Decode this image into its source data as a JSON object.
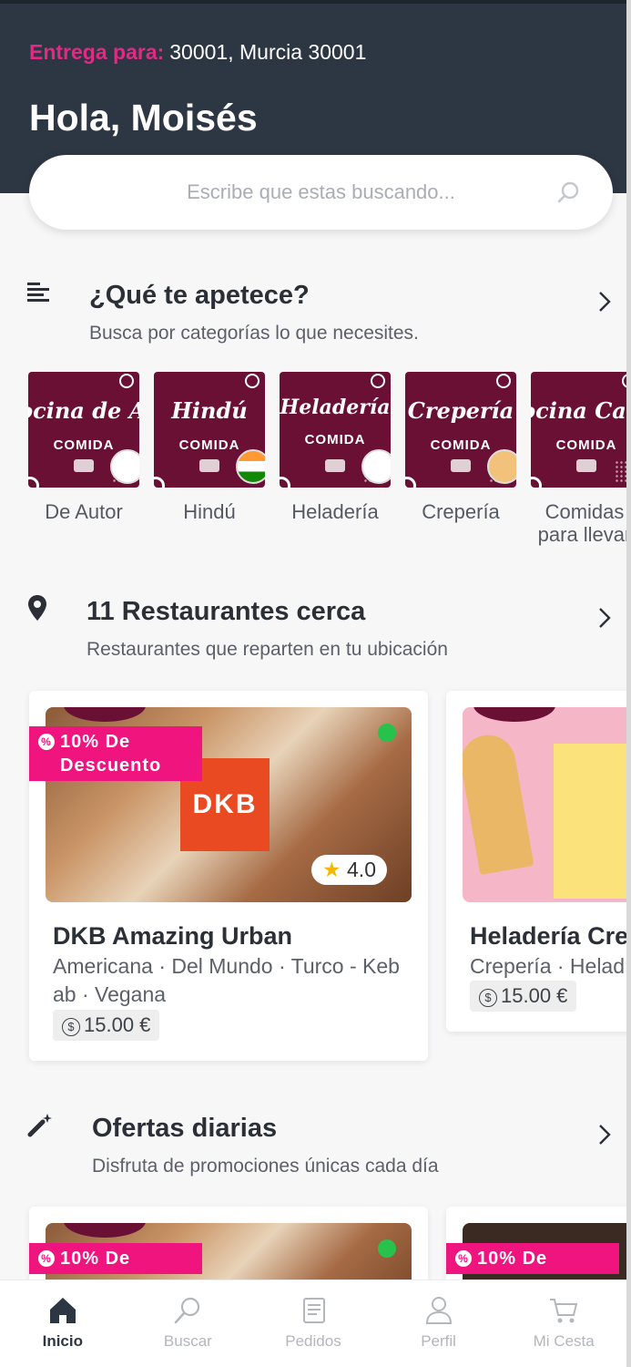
{
  "header": {
    "deliver_label": "Entrega para:",
    "address": "30001, Murcia 30001",
    "greeting": "Hola, Moisés"
  },
  "search": {
    "placeholder": "Escribe que estas buscando..."
  },
  "categories_section": {
    "title": "¿Qué te apetece?",
    "subtitle": "Busca por categorías lo que necesites.",
    "items": [
      {
        "image_title": "Cocina de Autor",
        "image_tag": "COMIDA",
        "label": "De Autor"
      },
      {
        "image_title": "Hindú",
        "image_tag": "COMIDA",
        "label": "Hindú"
      },
      {
        "image_title": "Heladería",
        "image_tag": "COMIDA",
        "label": "Heladería"
      },
      {
        "image_title": "Crepería",
        "image_tag": "COMIDA",
        "label": "Crepería"
      },
      {
        "image_title": "Cocina Casera",
        "image_tag": "COMIDA",
        "label": "Comidas para llevar"
      }
    ]
  },
  "restaurants_section": {
    "title": "11 Restaurantes cerca",
    "subtitle": "Restaurantes que reparten en tu ubicación",
    "items": [
      {
        "promo": "10% De Descuento",
        "logo_text": "DKB",
        "rating": "4.0",
        "name": "DKB Amazing Urban",
        "categories": "Americana · Del Mundo · Turco - Kebab · Vegana",
        "price": "15.00 €"
      },
      {
        "name": "Heladería Cre",
        "categories": "Crepería · Helad",
        "price": "15.00 €"
      }
    ]
  },
  "offers_section": {
    "title": "Ofertas diarias",
    "subtitle": "Disfruta de promociones únicas cada día",
    "items": [
      {
        "promo": "10% De"
      },
      {
        "promo": "10% De"
      }
    ]
  },
  "tabbar": {
    "items": [
      {
        "label": "Inicio",
        "icon": "home-icon",
        "active": true
      },
      {
        "label": "Buscar",
        "icon": "search-icon",
        "active": false
      },
      {
        "label": "Pedidos",
        "icon": "receipt-icon",
        "active": false
      },
      {
        "label": "Perfil",
        "icon": "user-icon",
        "active": false
      },
      {
        "label": "Mi Cesta",
        "icon": "cart-icon",
        "active": false
      }
    ]
  },
  "colors": {
    "header_bg": "#2d3643",
    "accent": "#e02a84",
    "promo": "#f0147e",
    "category_bg": "#6b1035",
    "online": "#27c24c"
  }
}
